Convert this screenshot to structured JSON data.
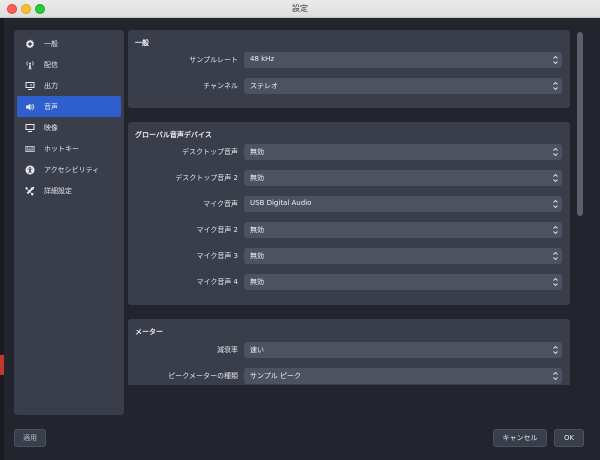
{
  "window": {
    "title": "設定"
  },
  "sidebar": {
    "items": [
      {
        "label": "一般",
        "icon": "gear-icon"
      },
      {
        "label": "配信",
        "icon": "antenna-icon"
      },
      {
        "label": "出力",
        "icon": "output-monitor-icon"
      },
      {
        "label": "音声",
        "icon": "speaker-icon",
        "active": true
      },
      {
        "label": "映像",
        "icon": "monitor-icon"
      },
      {
        "label": "ホットキー",
        "icon": "keyboard-icon"
      },
      {
        "label": "アクセシビリティ",
        "icon": "accessibility-icon"
      },
      {
        "label": "詳細設定",
        "icon": "tools-icon"
      }
    ]
  },
  "general": {
    "title": "一般",
    "sample_rate": {
      "label": "サンプルレート",
      "value": "48 kHz"
    },
    "channels": {
      "label": "チャンネル",
      "value": "ステレオ"
    }
  },
  "global_devices": {
    "title": "グローバル音声デバイス",
    "rows": [
      {
        "label": "デスクトップ音声",
        "value": "無効"
      },
      {
        "label": "デスクトップ音声 2",
        "value": "無効"
      },
      {
        "label": "マイク音声",
        "value": "USB Digital Audio"
      },
      {
        "label": "マイク音声 2",
        "value": "無効"
      },
      {
        "label": "マイク音声 3",
        "value": "無効"
      },
      {
        "label": "マイク音声 4",
        "value": "無効"
      }
    ]
  },
  "meters": {
    "title": "メーター",
    "decay": {
      "label": "減衰率",
      "value": "速い"
    },
    "peak_type": {
      "label": "ピークメーターの種類",
      "value": "サンプル ピーク"
    }
  },
  "footer": {
    "apply": "適用",
    "cancel": "キャンセル",
    "ok": "OK"
  },
  "colors": {
    "accent": "#2f5fcf",
    "panel": "#3a3e4a",
    "background": "#22252d",
    "field": "#4d5260"
  }
}
